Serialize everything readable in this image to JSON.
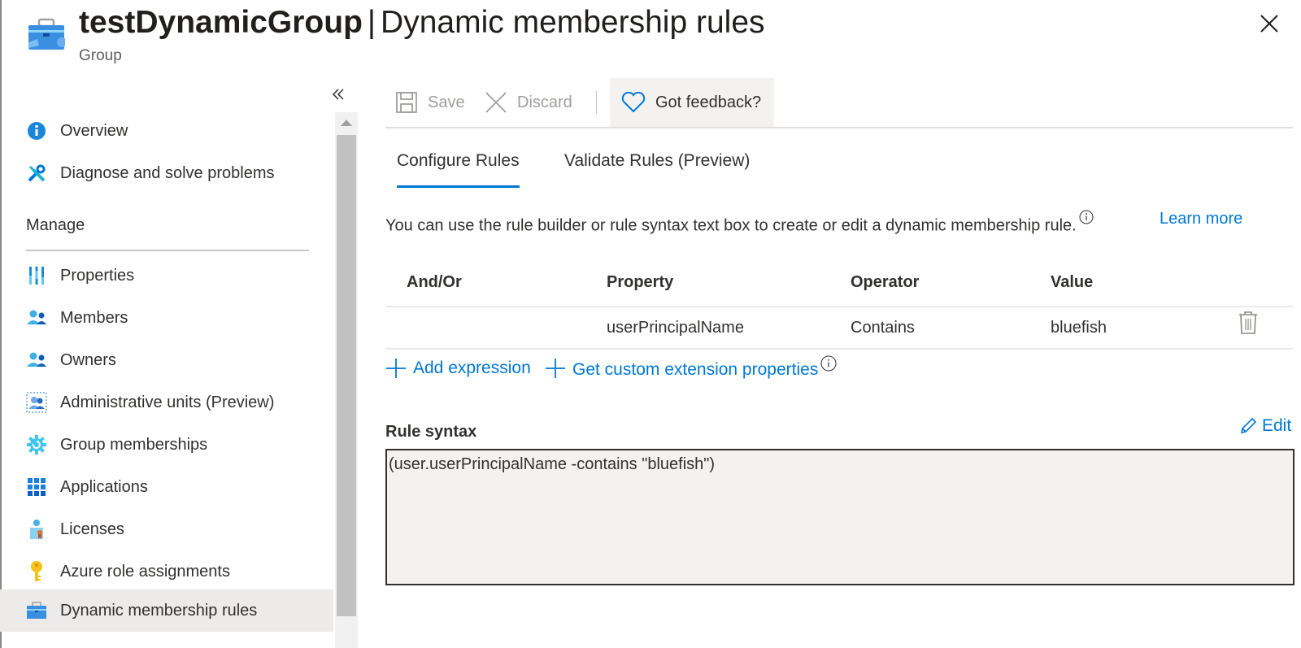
{
  "header": {
    "title_bold": "testDynamicGroup",
    "title_separator": "|",
    "title_rest": "Dynamic membership rules",
    "subtitle": "Group",
    "icon": "group-briefcase-icon",
    "close_icon": "close-icon"
  },
  "sidebar": {
    "collapse_icon": "double-chevron-left-icon",
    "items_top": [
      {
        "label": "Overview",
        "icon": "info-icon"
      },
      {
        "label": "Diagnose and solve problems",
        "icon": "wrench-screwdriver-icon"
      }
    ],
    "section_header": "Manage",
    "items_manage": [
      {
        "label": "Properties",
        "icon": "properties-bars-icon"
      },
      {
        "label": "Members",
        "icon": "people-icon"
      },
      {
        "label": "Owners",
        "icon": "people-icon"
      },
      {
        "label": "Administrative units (Preview)",
        "icon": "admin-units-icon"
      },
      {
        "label": "Group memberships",
        "icon": "gear-icon"
      },
      {
        "label": "Applications",
        "icon": "grid-icon"
      },
      {
        "label": "Licenses",
        "icon": "license-user-icon"
      },
      {
        "label": "Azure role assignments",
        "icon": "key-icon"
      },
      {
        "label": "Dynamic membership rules",
        "icon": "briefcase-icon",
        "active": true
      }
    ]
  },
  "toolbar": {
    "save_label": "Save",
    "discard_label": "Discard",
    "feedback_label": "Got feedback?"
  },
  "tabs": [
    {
      "label": "Configure Rules",
      "active": true
    },
    {
      "label": "Validate Rules (Preview)",
      "active": false
    }
  ],
  "description": "You can use the rule builder or rule syntax text box to create or edit a dynamic membership rule.",
  "learn_more": "Learn more",
  "rules_table": {
    "columns": [
      "And/Or",
      "Property",
      "Operator",
      "Value"
    ],
    "rows": [
      {
        "and_or": "",
        "property": "userPrincipalName",
        "operator": "Contains",
        "value": "bluefish"
      }
    ]
  },
  "actions": {
    "add_expression": "Add expression",
    "get_custom_extension": "Get custom extension properties"
  },
  "rule_syntax": {
    "label": "Rule syntax",
    "edit_label": "Edit",
    "value": "(user.userPrincipalName -contains \"bluefish\")"
  },
  "colors": {
    "accent": "#0078d4",
    "text": "#323130",
    "active_bg": "#edebe9"
  }
}
